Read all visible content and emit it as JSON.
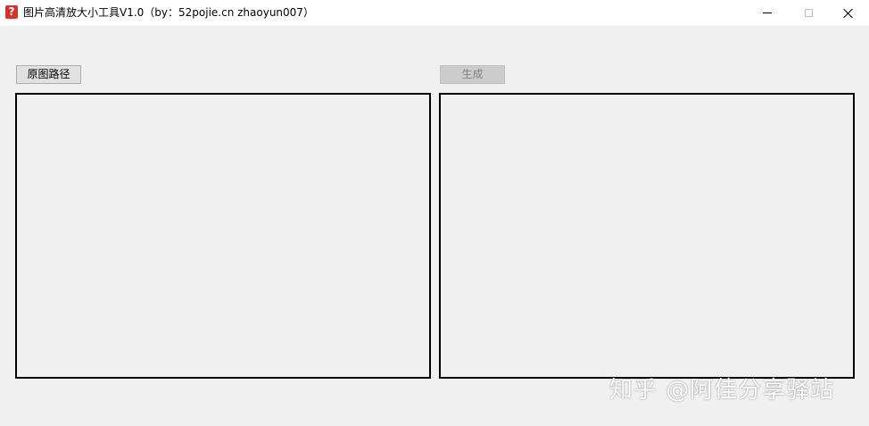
{
  "window": {
    "icon_glyph": "?",
    "icon_name": "app-question-icon",
    "title": "图片高清放大小工具V1.0（by：52pojie.cn zhaoyun007）"
  },
  "controls": {
    "source_button": "原图路径",
    "generate_button": "生成"
  },
  "watermark": {
    "text": "知乎 @阿佳分享驿站"
  }
}
